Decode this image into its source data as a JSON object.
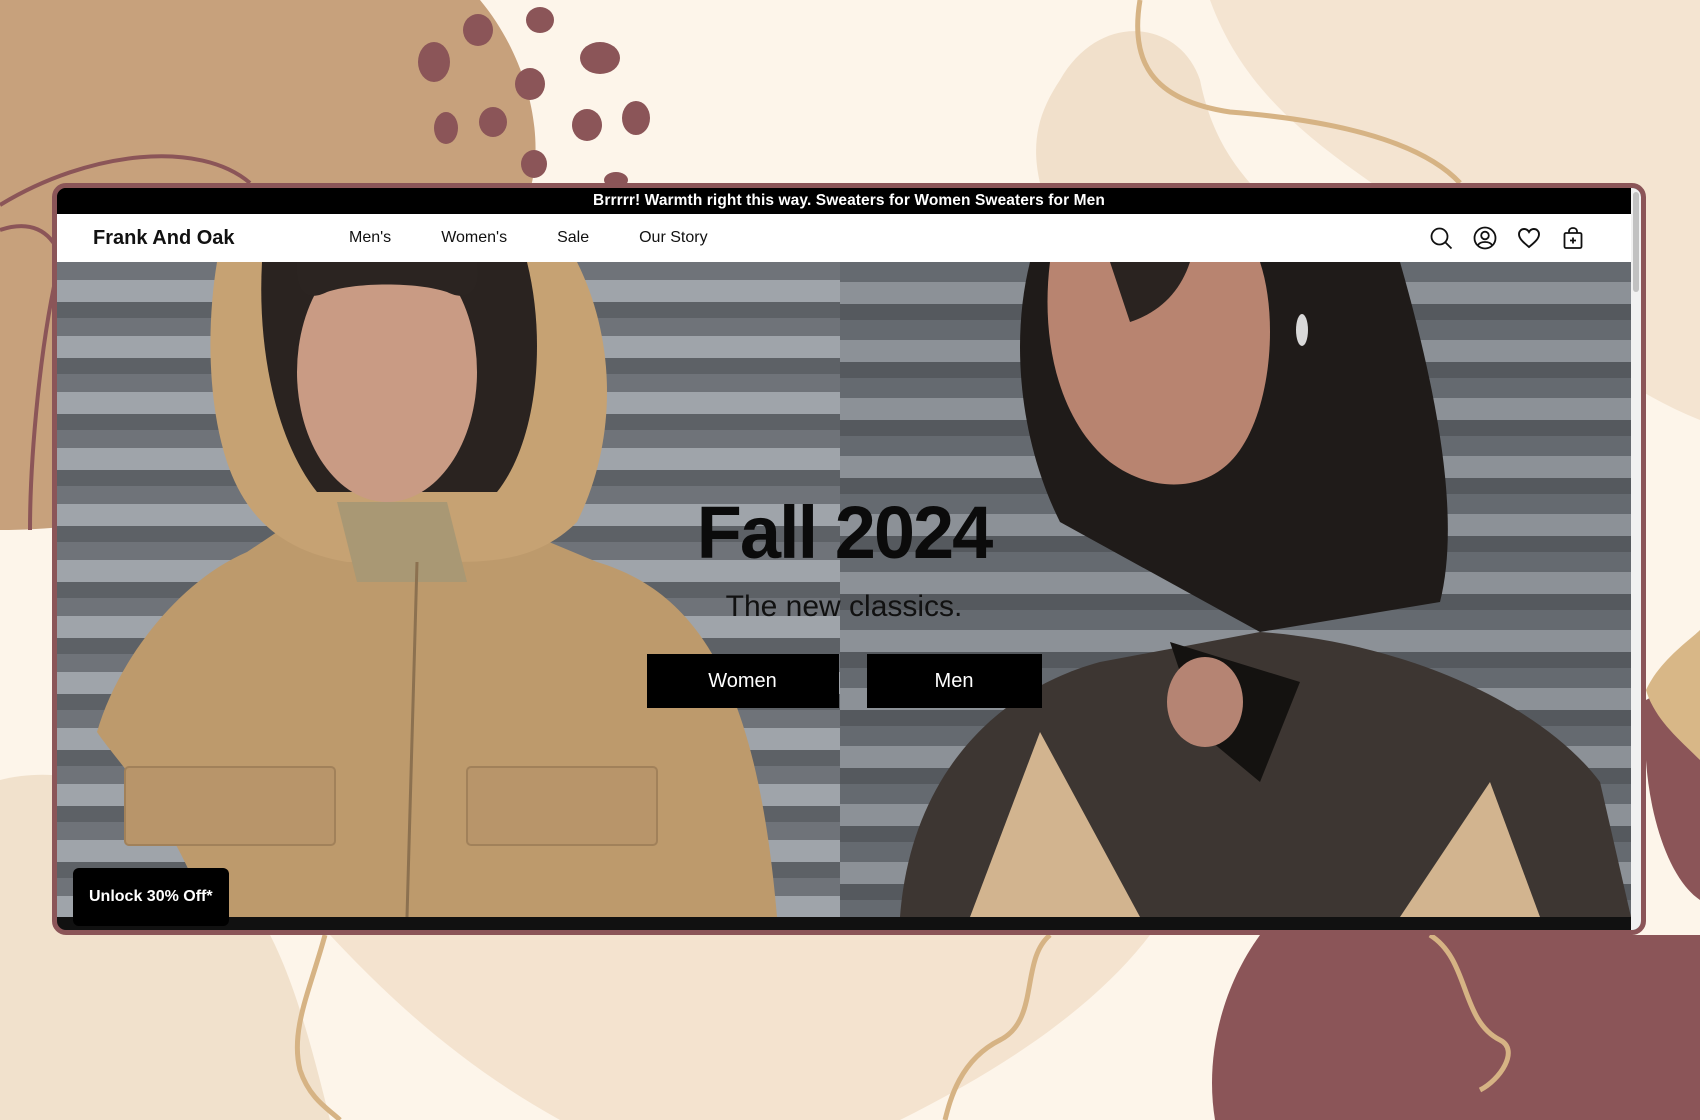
{
  "announcement": "Brrrrr! Warmth right this way. Sweaters for Women Sweaters for Men",
  "brand": "Frank And Oak",
  "nav": {
    "items": [
      {
        "label": "Men's"
      },
      {
        "label": "Women's"
      },
      {
        "label": "Sale"
      },
      {
        "label": "Our Story"
      }
    ],
    "icons": [
      "search-icon",
      "account-icon",
      "wishlist-heart-icon",
      "shopping-bag-icon"
    ]
  },
  "hero": {
    "title": "Fall 2024",
    "subtitle": "The new classics.",
    "buttons": [
      {
        "label": "Women"
      },
      {
        "label": "Men"
      }
    ]
  },
  "promo": {
    "label": "Unlock 30% Off*"
  },
  "colors": {
    "frame": "#8b5558",
    "background": "#fdf5ea",
    "accent_tan": "#c6a27d",
    "button": "#000000"
  }
}
